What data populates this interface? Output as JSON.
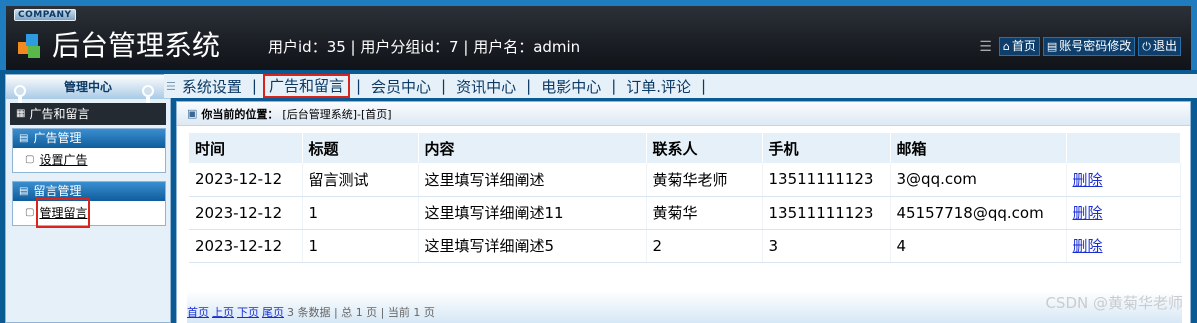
{
  "header": {
    "company": "COMPANY",
    "title": "后台管理系统",
    "user_info": "用户id：35 | 用户分组id：7 | 用户名：admin",
    "links": [
      {
        "icon": "home-icon",
        "label": "首页"
      },
      {
        "icon": "account-icon",
        "label": "账号密码修改"
      },
      {
        "icon": "power-icon",
        "label": "退出"
      }
    ]
  },
  "sidebar": {
    "title": "管理中心",
    "current": "广告和留言",
    "groups": [
      {
        "title": "广告管理",
        "items": [
          {
            "label": "设置广告"
          }
        ]
      },
      {
        "title": "留言管理",
        "items": [
          {
            "label": "管理留言"
          }
        ]
      }
    ]
  },
  "nav": {
    "tabs": [
      "系统设置",
      "广告和留言",
      "会员中心",
      "资讯中心",
      "电影中心",
      "订单.评论"
    ],
    "active": "广告和留言"
  },
  "breadcrumb": {
    "label": "你当前的位置：",
    "path": "[后台管理系统]-[首页]"
  },
  "table": {
    "columns": [
      "时间",
      "标题",
      "内容",
      "联系人",
      "手机",
      "邮箱",
      ""
    ],
    "rows": [
      {
        "time": "2023-12-12",
        "title": "留言测试",
        "content": "这里填写详细阐述",
        "contact": "黄菊华老师",
        "phone": "13511111123",
        "email": "3@qq.com",
        "action": "删除"
      },
      {
        "time": "2023-12-12",
        "title": "1",
        "content": "这里填写详细阐述11",
        "contact": "黄菊华",
        "phone": "13511111123",
        "email": "45157718@qq.com",
        "action": "删除"
      },
      {
        "time": "2023-12-12",
        "title": "1",
        "content": "这里填写详细阐述5",
        "contact": "2",
        "phone": "3",
        "email": "4",
        "action": "删除"
      }
    ]
  },
  "pager": {
    "first": "首页",
    "prev": "上页",
    "next": "下页",
    "last": "尾页",
    "summary": "3 条数据 | 总 1 页 | 当前 1 页"
  },
  "watermark": "CSDN @黄菊华老师"
}
